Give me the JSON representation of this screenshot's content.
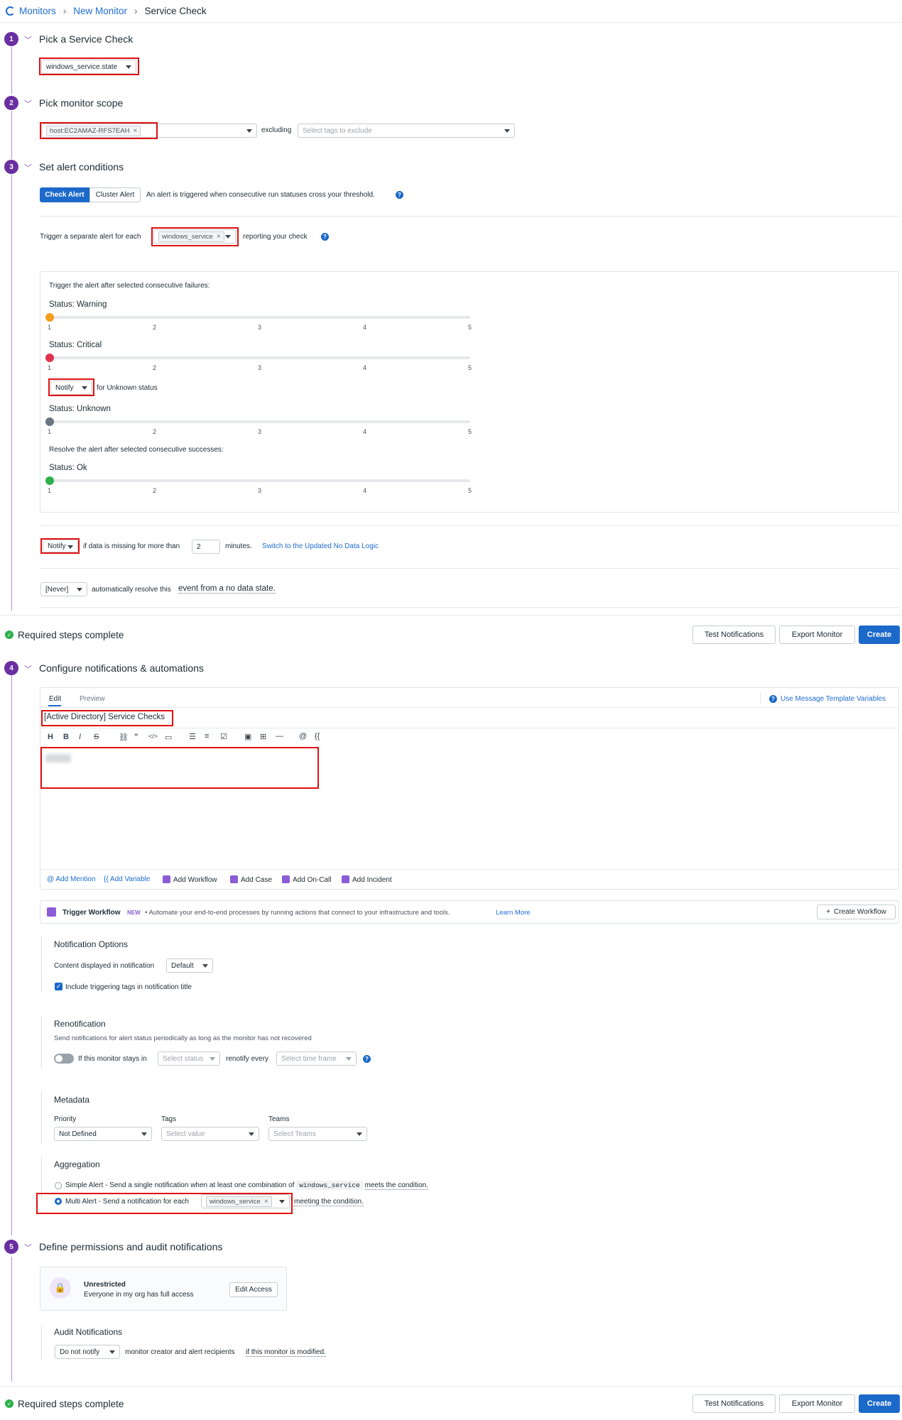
{
  "breadcrumb": {
    "root": "Monitors",
    "parent": "New Monitor",
    "current": "Service Check"
  },
  "steps": [
    {
      "num": "1",
      "title": "Pick a Service Check"
    },
    {
      "num": "2",
      "title": "Pick monitor scope"
    },
    {
      "num": "3",
      "title": "Set alert conditions"
    },
    {
      "num": "4",
      "title": "Configure notifications & automations"
    },
    {
      "num": "5",
      "title": "Define permissions and audit notifications"
    }
  ],
  "step1": {
    "check": "windows_service.state"
  },
  "step2": {
    "scope_tag": "host:EC2AMAZ-RFS7EAH",
    "excluding_label": "excluding",
    "exclude_placeholder": "Select tags to exclude"
  },
  "step3": {
    "tabs": [
      "Check Alert",
      "Cluster Alert"
    ],
    "tab_desc": "An alert is triggered when consecutive run statuses cross your threshold.",
    "group_prefix": "Trigger a separate alert for each",
    "group_tag": "windows_service",
    "group_suffix": "reporting your check",
    "failures_label": "Trigger the alert after selected consecutive failures:",
    "sliders": [
      {
        "label": "Status: Warning",
        "value": 1,
        "color": "#f29d1b"
      },
      {
        "label": "Status: Critical",
        "value": 1,
        "color": "#e0334e"
      },
      {
        "label": "Status: Unknown",
        "value": 1,
        "color": "#6c7680"
      },
      {
        "label": "Status: Ok",
        "value": 1,
        "color": "#2eb04b"
      }
    ],
    "ticks": [
      "1",
      "2",
      "3",
      "4",
      "5"
    ],
    "unknown_select": "Notify",
    "unknown_suffix": "for Unknown status",
    "successes_label": "Resolve the alert after selected consecutive successes:",
    "nodata_select": "Notify",
    "nodata_text": "if data is missing for more than",
    "nodata_minutes": "2",
    "minutes_label": "minutes.",
    "nodata_link": "Switch to the Updated No Data Logic",
    "resolve_select": "[Never]",
    "resolve_text": "automatically resolve this",
    "resolve_link": "event from a no data state."
  },
  "status_bar": {
    "text": "Required steps complete",
    "test": "Test Notifications",
    "export": "Export Monitor",
    "create": "Create"
  },
  "step4": {
    "tab_edit": "Edit",
    "tab_preview": "Preview",
    "template_link": "Use Message Template Variables",
    "title_value": "[Active Directory] Service Checks",
    "footer": {
      "mention": "Add Mention",
      "variable": "Add Variable",
      "workflow": "Add Workflow",
      "case": "Add Case",
      "oncall": "Add On-Call",
      "incident": "Add Incident"
    },
    "trigger_workflow": {
      "title": "Trigger Workflow",
      "badge": "NEW",
      "desc": "• Automate your end-to-end processes by running actions that connect to your infrastructure and tools.",
      "learn": "Learn More",
      "create": "Create Workflow"
    },
    "notif_options": {
      "title": "Notification Options",
      "content_label": "Content displayed in notification",
      "content_value": "Default",
      "include_tags": "Include triggering tags in notification title"
    },
    "renotification": {
      "title": "Renotification",
      "desc": "Send notifications for alert status periodically as long as the monitor has not recovered",
      "stays_in": "If this monitor stays in",
      "status_placeholder": "Select status",
      "every": "renotify every",
      "time_placeholder": "Select time frame"
    },
    "metadata": {
      "title": "Metadata",
      "priority_label": "Priority",
      "priority_value": "Not Defined",
      "tags_label": "Tags",
      "tags_placeholder": "Select value",
      "teams_label": "Teams",
      "teams_placeholder": "Select Teams"
    },
    "aggregation": {
      "title": "Aggregation",
      "simple": "Simple Alert - Send a single notification when at least one combination of",
      "simple_code": "windows_service",
      "simple_suffix": "meets the condition.",
      "multi": "Multi Alert - Send a notification for each",
      "multi_tag": "windows_service",
      "multi_suffix": "meeting the condition."
    }
  },
  "step5": {
    "access_title": "Unrestricted",
    "access_desc": "Everyone in my org has full access",
    "edit_access": "Edit Access",
    "audit_title": "Audit Notifications",
    "audit_select": "Do not notify",
    "audit_text": "monitor creator and alert recipients",
    "audit_link": "if this monitor is modified."
  }
}
